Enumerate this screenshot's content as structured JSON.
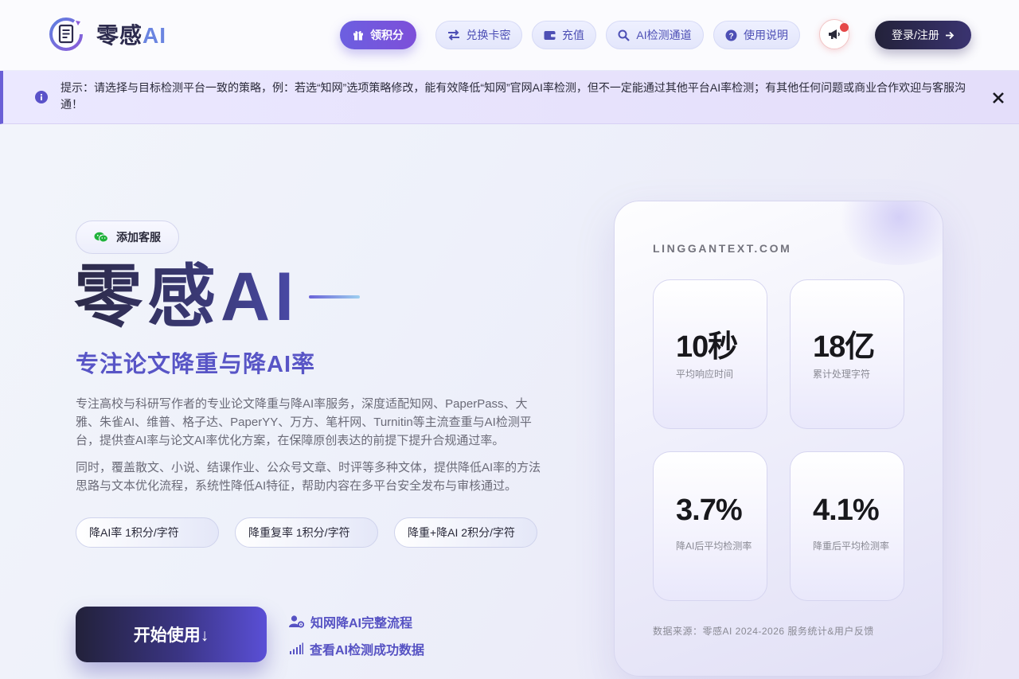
{
  "header": {
    "logo_text": "零感",
    "logo_text_ai": "AI",
    "nav": {
      "points": "领积分",
      "redeem": "兑换卡密",
      "recharge": "充值",
      "ai_detect": "AI检测通道",
      "guide": "使用说明"
    },
    "login": "登录/注册"
  },
  "notice": {
    "text": "提示：请选择与目标检测平台一致的策略，例：若选“知网”选项策略修改，能有效降低“知网”官网AI率检测，但不一定能通过其他平台AI率检测；有其他任何问题或商业合作欢迎与客服沟通！"
  },
  "hero": {
    "wechat_button": "添加客服",
    "title": "零感AI",
    "subtitle": "专注论文降重与降AI率",
    "desc1": "专注高校与科研写作者的专业论文降重与降AI率服务，深度适配知网、PaperPass、大雅、朱雀AI、维普、格子达、PaperYY、万方、笔杆网、Turnitin等主流查重与AI检测平台，提供查AI率与论文AI率优化方案，在保障原创表达的前提下提升合规通过率。",
    "desc2": "同时，覆盖散文、小说、结课作业、公众号文章、时评等多种文体，提供降低AI率的方法思路与文本优化流程，系统性降低AI特征，帮助内容在多平台安全发布与审核通过。",
    "prices": [
      "降AI率 1积分/字符",
      "降重复率 1积分/字符",
      "降重+降AI 2积分/字符"
    ],
    "start_button": "开始使用↓",
    "link_flow": "知网降AI完整流程",
    "link_data": "查看AI检测成功数据"
  },
  "stats": {
    "site": "LINGGANTEXT.COM",
    "items": [
      {
        "value": "10秒",
        "label": "平均响应时间"
      },
      {
        "value": "18亿",
        "label": "累计处理字符"
      },
      {
        "value": "3.7%",
        "label": "降AI后平均检测率"
      },
      {
        "value": "4.1%",
        "label": "降重后平均检测率"
      }
    ],
    "source": "数据来源：零感AI 2024-2026 服务统计&用户反馈"
  },
  "colors": {
    "accent": "#5855c6",
    "primary_button": "#6c5fe0",
    "dark_button": "#23223a",
    "notice_bg": "#ebe8ff",
    "badge_red": "#e54848"
  }
}
